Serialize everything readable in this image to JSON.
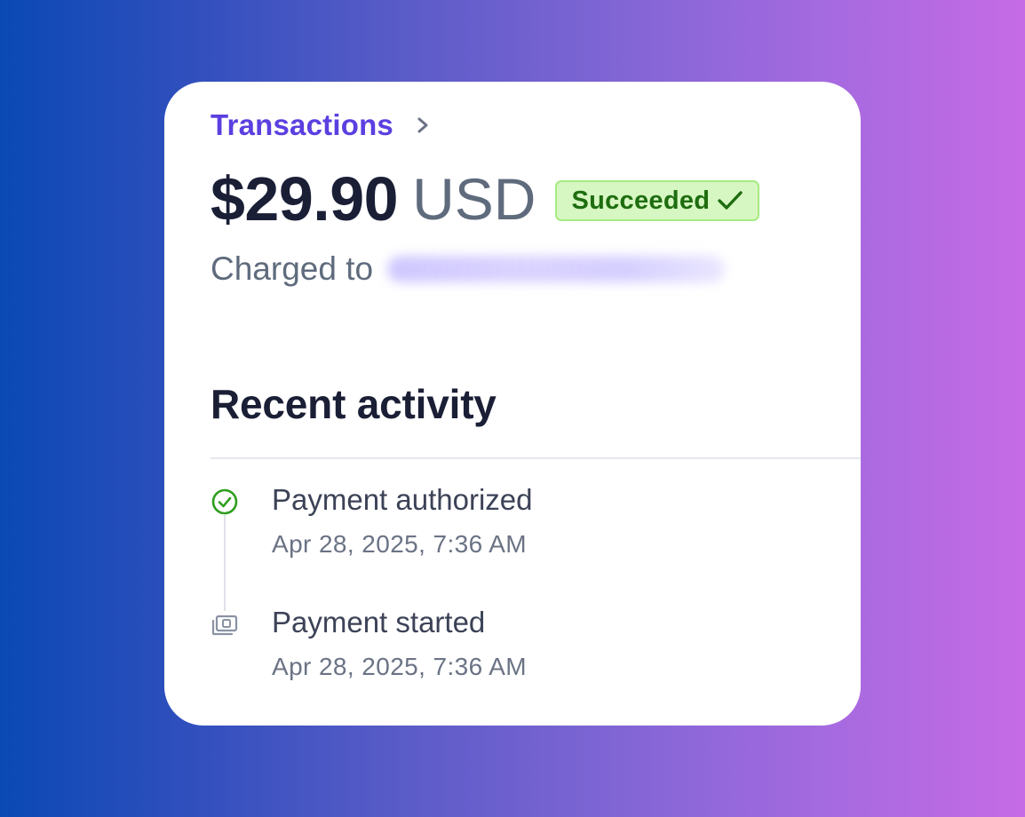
{
  "breadcrumb": {
    "label": "Transactions"
  },
  "payment": {
    "amount": "$29.90",
    "currency": "USD",
    "status": "Succeeded",
    "charged_to_label": "Charged to"
  },
  "activity": {
    "title": "Recent activity",
    "events": [
      {
        "title": "Payment authorized",
        "time": "Apr 28, 2025, 7:36 AM",
        "icon": "check-circle-icon"
      },
      {
        "title": "Payment started",
        "time": "Apr 28, 2025, 7:36 AM",
        "icon": "payment-started-icon"
      }
    ]
  },
  "colors": {
    "accent": "#5b3fe0",
    "success_bg": "#d7f7c2",
    "success_text": "#1e6d10",
    "check_green": "#2f9e1f"
  }
}
